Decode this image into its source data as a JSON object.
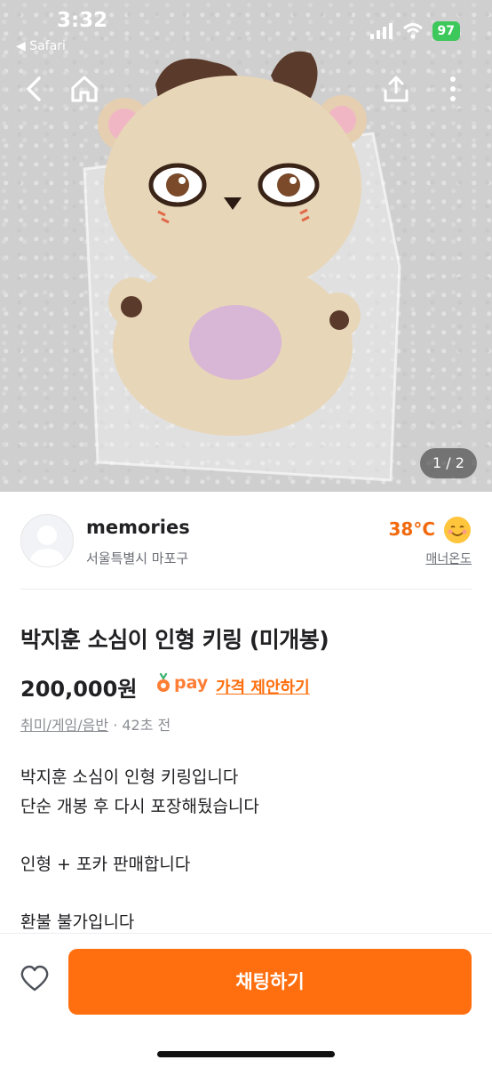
{
  "status_bar": {
    "time": "3:32",
    "back_app": "◀ Safari",
    "battery": "97"
  },
  "photo": {
    "pager": "1 / 2"
  },
  "seller": {
    "name": "memories",
    "location": "서울특별시 마포구",
    "temperature": "38°C",
    "manner_label": "매너온도"
  },
  "product": {
    "title": "박지훈 소심이 인형 키링 (미개봉)",
    "price": "200,000원",
    "pay_label": "pay",
    "offer_label": "가격 제안하기",
    "category": "취미/게임/음반",
    "time_ago": "· 42초 전",
    "description": [
      "박지훈 소심이 인형 키링입니다",
      "단순 개봉 후 다시 포장해뒀습니다",
      "",
      "인형 + 포카 판매합니다",
      "",
      "환불 불가입니다"
    ]
  },
  "bottom_bar": {
    "chat_label": "채팅하기"
  },
  "colors": {
    "accent": "#ff6f0f",
    "temperature": "#f26a0f",
    "battery": "#3cc85a"
  },
  "icons": [
    "back-icon",
    "home-icon",
    "share-icon",
    "more-icon",
    "heart-icon",
    "smile-face-icon"
  ]
}
